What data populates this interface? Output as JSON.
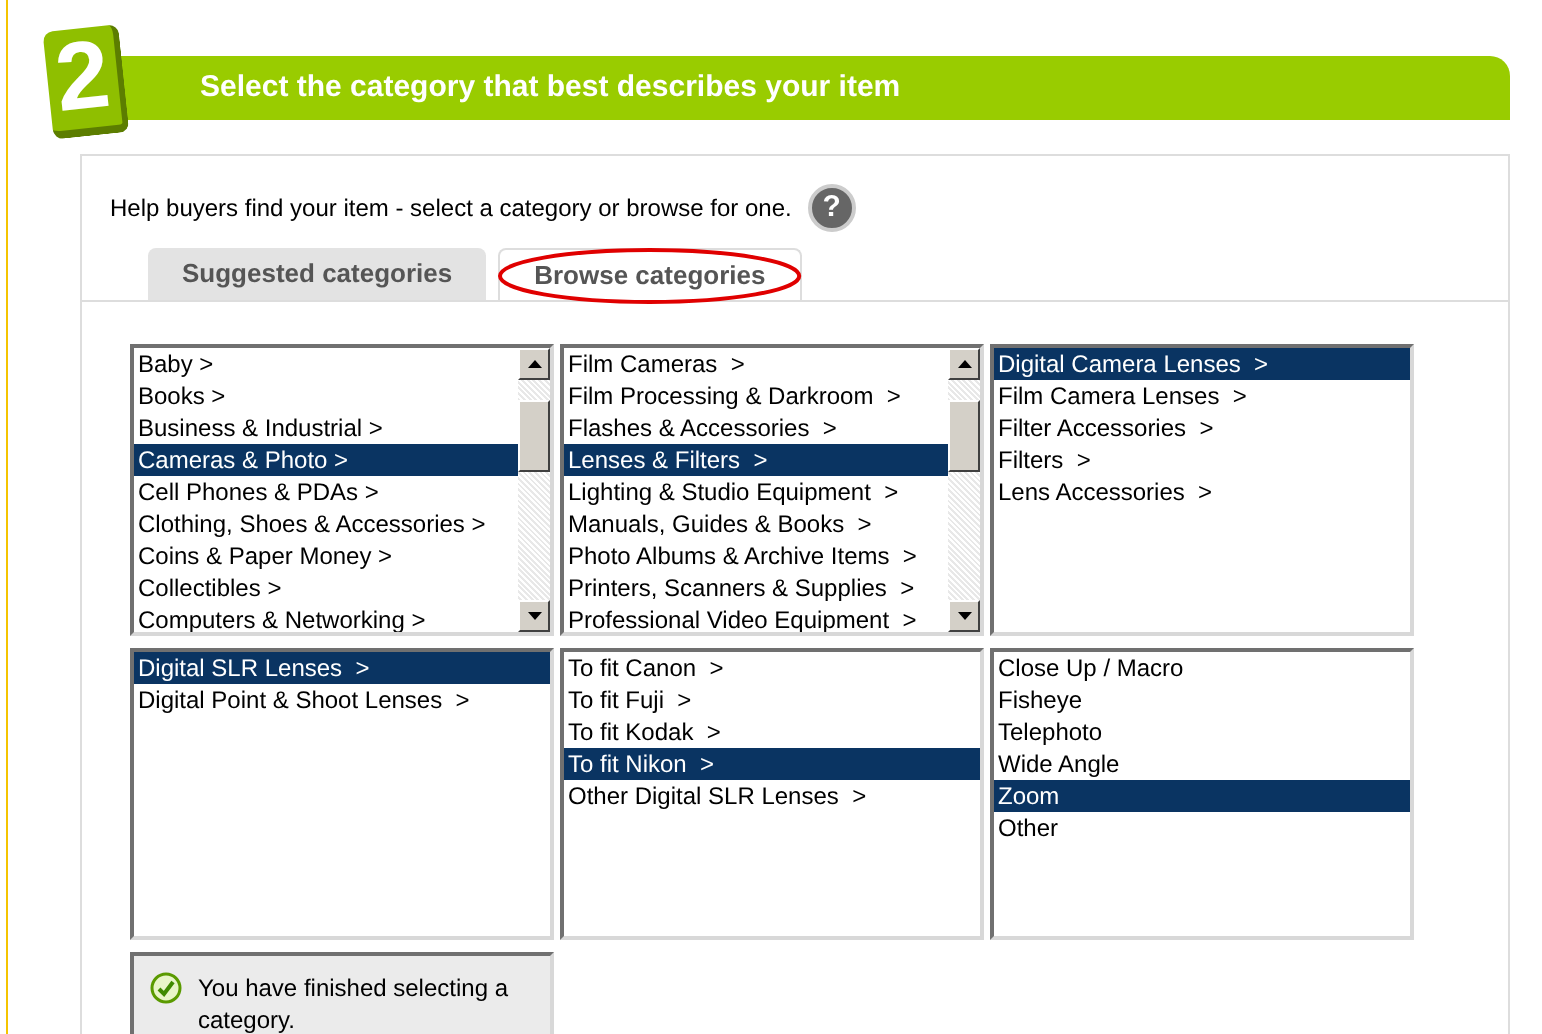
{
  "step": {
    "number": "2",
    "title": "Select the category that best describes your item"
  },
  "help_text": "Help buyers find your item - select a category or browse for one.",
  "help_icon": "?",
  "tabs": [
    {
      "label": "Suggested categories",
      "selected": false,
      "circled": false
    },
    {
      "label": "Browse categories",
      "selected": true,
      "circled": true
    }
  ],
  "lists": [
    {
      "scrollable": true,
      "items": [
        {
          "label": "Baby >",
          "selected": false
        },
        {
          "label": "Books >",
          "selected": false
        },
        {
          "label": "Business & Industrial >",
          "selected": false
        },
        {
          "label": "Cameras & Photo >",
          "selected": true
        },
        {
          "label": "Cell Phones & PDAs >",
          "selected": false
        },
        {
          "label": "Clothing, Shoes & Accessories >",
          "selected": false
        },
        {
          "label": "Coins & Paper Money >",
          "selected": false
        },
        {
          "label": "Collectibles >",
          "selected": false
        },
        {
          "label": "Computers & Networking >",
          "selected": false
        }
      ]
    },
    {
      "scrollable": true,
      "items": [
        {
          "label": "Film Cameras  >",
          "selected": false
        },
        {
          "label": "Film Processing & Darkroom  >",
          "selected": false
        },
        {
          "label": "Flashes & Accessories  >",
          "selected": false
        },
        {
          "label": "Lenses & Filters  >",
          "selected": true
        },
        {
          "label": "Lighting & Studio Equipment  >",
          "selected": false
        },
        {
          "label": "Manuals, Guides & Books  >",
          "selected": false
        },
        {
          "label": "Photo Albums & Archive Items  >",
          "selected": false
        },
        {
          "label": "Printers, Scanners & Supplies  >",
          "selected": false
        },
        {
          "label": "Professional Video Equipment  >",
          "selected": false
        }
      ]
    },
    {
      "scrollable": false,
      "items": [
        {
          "label": "Digital Camera Lenses  >",
          "selected": true
        },
        {
          "label": "Film Camera Lenses  >",
          "selected": false
        },
        {
          "label": "Filter Accessories  >",
          "selected": false
        },
        {
          "label": "Filters  >",
          "selected": false
        },
        {
          "label": "Lens Accessories  >",
          "selected": false
        }
      ]
    },
    {
      "scrollable": false,
      "items": [
        {
          "label": "Digital SLR Lenses  >",
          "selected": true
        },
        {
          "label": "Digital Point & Shoot Lenses  >",
          "selected": false
        }
      ]
    },
    {
      "scrollable": false,
      "items": [
        {
          "label": "To fit Canon  >",
          "selected": false
        },
        {
          "label": "To fit Fuji  >",
          "selected": false
        },
        {
          "label": "To fit Kodak  >",
          "selected": false
        },
        {
          "label": "To fit Nikon  >",
          "selected": true
        },
        {
          "label": "Other Digital SLR Lenses  >",
          "selected": false
        }
      ]
    },
    {
      "scrollable": false,
      "items": [
        {
          "label": "Close Up / Macro",
          "selected": false
        },
        {
          "label": "Fisheye",
          "selected": false
        },
        {
          "label": "Telephoto",
          "selected": false
        },
        {
          "label": "Wide Angle",
          "selected": false
        },
        {
          "label": "Zoom",
          "selected": true
        },
        {
          "label": "Other",
          "selected": false
        }
      ]
    }
  ],
  "status": {
    "done": true,
    "text": "You have finished selecting a category."
  }
}
